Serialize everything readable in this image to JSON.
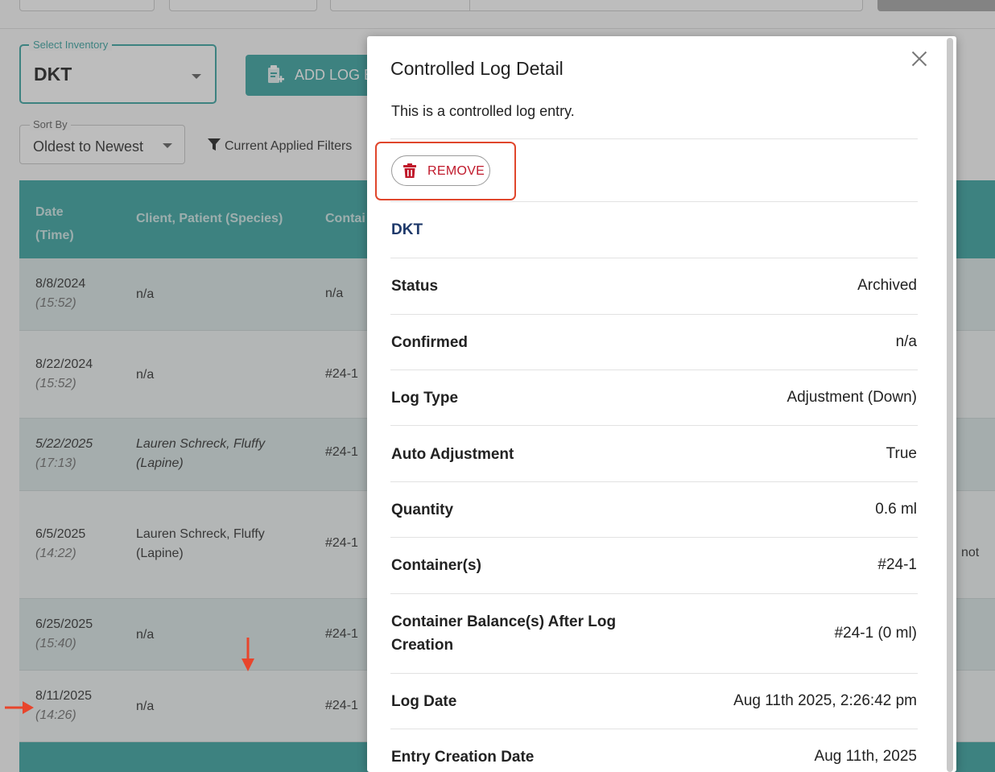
{
  "background": {
    "select_inventory": {
      "label": "Select Inventory",
      "value": "DKT"
    },
    "add_log_button": "ADD LOG E",
    "sort_by": {
      "label": "Sort By",
      "value": "Oldest to Newest"
    },
    "filters_label": "Current Applied Filters",
    "table": {
      "headers": {
        "date_line1": "Date",
        "date_line2": "(Time)",
        "client": "Client, Patient (Species)",
        "container": "Contai"
      },
      "rows": [
        {
          "date": "8/8/2024",
          "time": "(15:52)",
          "client_line1": "n/a",
          "client_line2": "",
          "container": "n/a",
          "tail": ""
        },
        {
          "date": "8/22/2024",
          "time": "(15:52)",
          "client_line1": "n/a",
          "client_line2": "",
          "container": "#24-1",
          "tail": ""
        },
        {
          "date": "5/22/2025",
          "time": "(17:13)",
          "client_line1": "Lauren Schreck, Fluffy",
          "client_line2": "(Lapine)",
          "container": "#24-1",
          "tail": ""
        },
        {
          "date": "6/5/2025",
          "time": "(14:22)",
          "client_line1": "Lauren Schreck, Fluffy",
          "client_line2": "(Lapine)",
          "container": "#24-1",
          "tail": "not"
        },
        {
          "date": "6/25/2025",
          "time": "(15:40)",
          "client_line1": "n/a",
          "client_line2": "",
          "container": "#24-1",
          "tail": ""
        },
        {
          "date": "8/11/2025",
          "time": "(14:26)",
          "client_line1": "n/a",
          "client_line2": "",
          "container": "#24-1",
          "tail": ""
        }
      ]
    }
  },
  "modal": {
    "title": "Controlled Log Detail",
    "description": "This is a controlled log entry.",
    "remove_label": "REMOVE",
    "inventory_name": "DKT",
    "details": [
      {
        "label": "Status",
        "value": "Archived"
      },
      {
        "label": "Confirmed",
        "value": "n/a"
      },
      {
        "label": "Log Type",
        "value": "Adjustment (Down)"
      },
      {
        "label": "Auto Adjustment",
        "value": "True"
      },
      {
        "label": "Quantity",
        "value": "0.6 ml"
      },
      {
        "label": "Container(s)",
        "value": "#24-1"
      },
      {
        "label": "Container Balance(s) After Log Creation",
        "value": "#24-1 (0 ml)"
      },
      {
        "label": "Log Date",
        "value": "Aug 11th 2025, 2:26:42 pm"
      },
      {
        "label": "Entry Creation Date",
        "value": "Aug 11th, 2025"
      }
    ]
  },
  "colors": {
    "brand_teal": "#2a9d9a",
    "remove_red": "#c0192b",
    "highlight_orange": "#e0462c",
    "inventory_navy": "#1f3a6b"
  },
  "icons": [
    "add-log-icon",
    "filter-icon",
    "trash-icon",
    "close-icon",
    "annotation-arrow-down",
    "annotation-arrow-right"
  ]
}
